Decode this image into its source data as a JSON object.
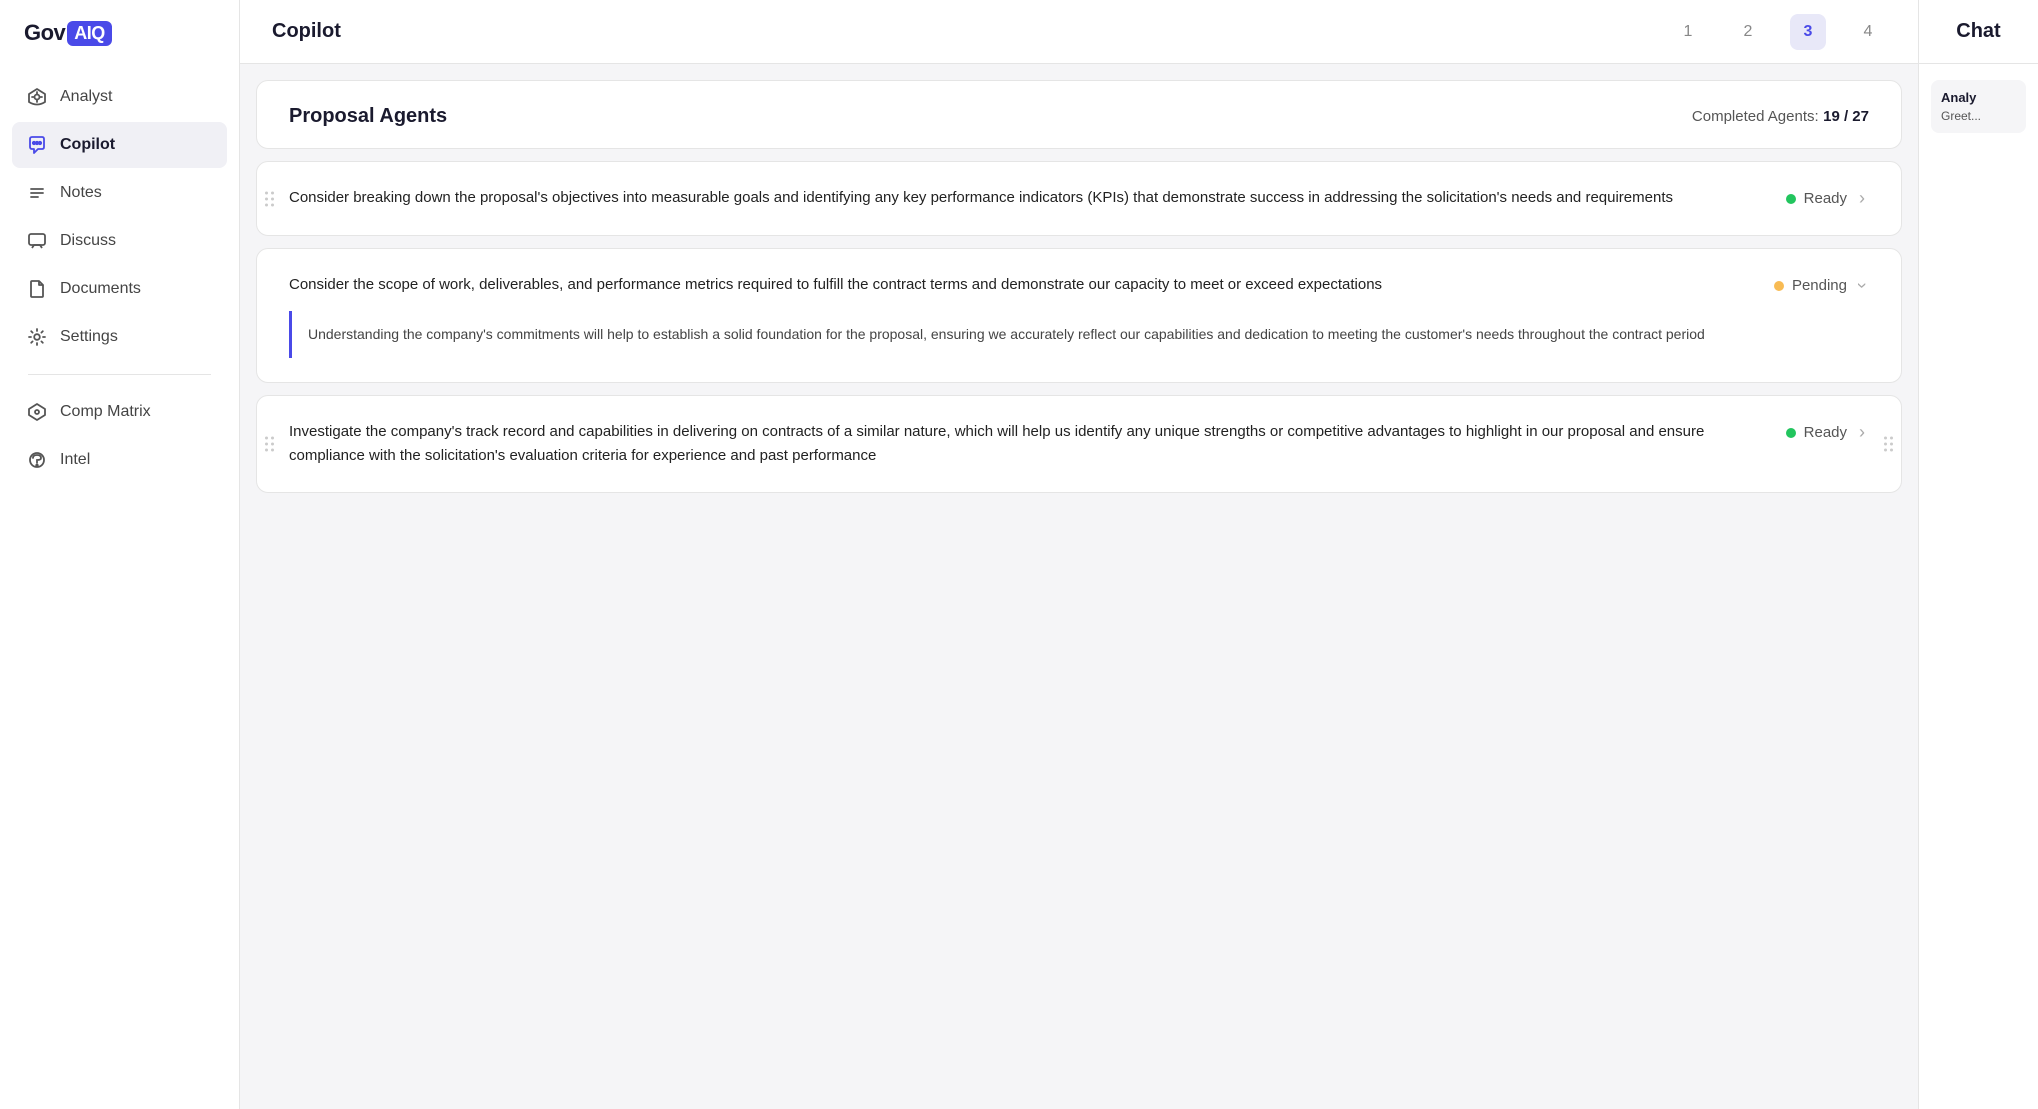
{
  "logo": {
    "prefix": "Gov",
    "brand": "AIQ"
  },
  "sidebar": {
    "items": [
      {
        "id": "analyst",
        "label": "Analyst",
        "icon": "analyst"
      },
      {
        "id": "copilot",
        "label": "Copilot",
        "icon": "copilot",
        "active": true
      },
      {
        "id": "notes",
        "label": "Notes",
        "icon": "notes"
      },
      {
        "id": "discuss",
        "label": "Discuss",
        "icon": "discuss"
      },
      {
        "id": "documents",
        "label": "Documents",
        "icon": "documents"
      },
      {
        "id": "settings",
        "label": "Settings",
        "icon": "settings"
      }
    ],
    "divider_items": [
      {
        "id": "comp-matrix",
        "label": "Comp Matrix",
        "icon": "comp-matrix"
      },
      {
        "id": "intel",
        "label": "Intel",
        "icon": "intel"
      }
    ]
  },
  "header": {
    "title": "Copilot",
    "tabs": [
      {
        "num": "1"
      },
      {
        "num": "2"
      },
      {
        "num": "3",
        "active": true
      },
      {
        "num": "4"
      }
    ]
  },
  "chat": {
    "label": "Chat",
    "preview_sender": "Analy",
    "preview_text": "Greet..."
  },
  "proposal": {
    "title": "Proposal Agents",
    "completed_label": "Completed Agents:",
    "completed_value": "19 / 27"
  },
  "agents": [
    {
      "id": "agent-1",
      "text": "Consider breaking down the proposal's objectives into measurable goals and identifying any key performance indicators (KPIs) that demonstrate success in addressing the solicitation's needs and requirements",
      "status": "Ready",
      "status_type": "green",
      "has_note": false
    },
    {
      "id": "agent-2",
      "text": "Consider the scope of work, deliverables, and performance metrics required to fulfill the contract terms and demonstrate our capacity to meet or exceed expectations",
      "status": "Pending",
      "status_type": "orange",
      "has_note": true,
      "note_text": "Understanding the company's commitments will help to establish a solid foundation for the proposal, ensuring we accurately reflect our capabilities and dedication to meeting the customer's needs throughout the contract period"
    },
    {
      "id": "agent-3",
      "text": "Investigate the company's track record and capabilities in delivering on contracts of a similar nature, which will help us identify any unique strengths or competitive advantages to highlight in our proposal and ensure compliance with the solicitation's evaluation criteria for experience and past performance",
      "status": "Ready",
      "status_type": "green",
      "has_note": false
    }
  ],
  "colors": {
    "accent": "#4a4ae8",
    "green": "#22c55e",
    "orange": "#f59e0b",
    "border": "#e5e5e5"
  }
}
